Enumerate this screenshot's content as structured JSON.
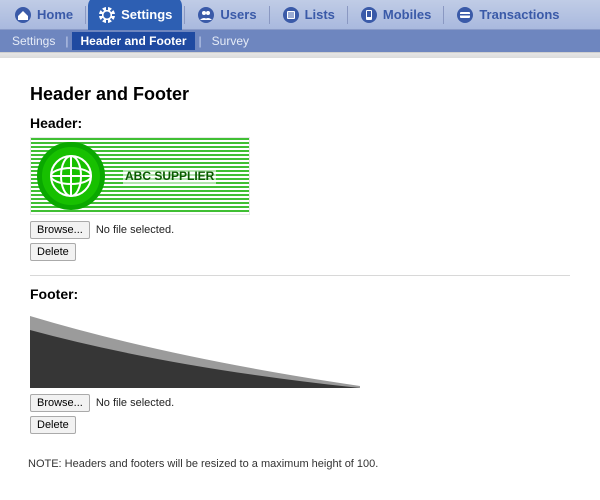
{
  "top_nav": {
    "items": [
      {
        "label": "Home",
        "icon": "home-icon"
      },
      {
        "label": "Settings",
        "icon": "gear-icon",
        "active": true
      },
      {
        "label": "Users",
        "icon": "users-icon"
      },
      {
        "label": "Lists",
        "icon": "list-icon"
      },
      {
        "label": "Mobiles",
        "icon": "mobile-icon"
      },
      {
        "label": "Transactions",
        "icon": "transaction-icon"
      }
    ]
  },
  "sub_nav": {
    "items": [
      {
        "label": "Settings"
      },
      {
        "label": "Header and Footer",
        "active": true
      },
      {
        "label": "Survey"
      }
    ]
  },
  "page": {
    "title": "Header and Footer",
    "header_label": "Header:",
    "footer_label": "Footer:",
    "note": "NOTE: Headers and footers will be resized to a maximum height of 100."
  },
  "header_image": {
    "supplier_text": "ABC SUPPLIER"
  },
  "controls": {
    "browse_label": "Browse...",
    "file_status": "No file selected.",
    "delete_label": "Delete"
  }
}
